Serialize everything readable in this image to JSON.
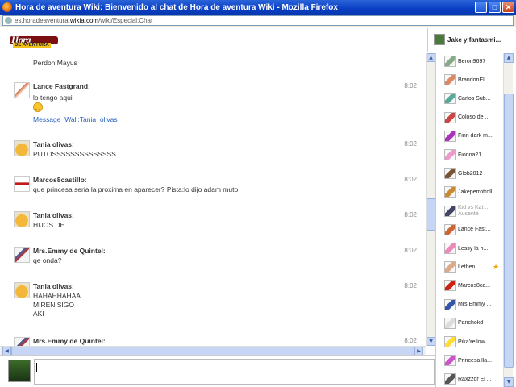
{
  "window": {
    "title": "Hora de aventura Wiki: Bienvenido al chat de Hora de aventura Wiki - Mozilla Firefox",
    "minimize": "_",
    "maximize": "□",
    "close": "✕"
  },
  "address": {
    "prefix": "es.horadeaventura.",
    "domain": "wikia.com",
    "path": "/wiki/Especial:Chat"
  },
  "header": {
    "logo_text": "Hora",
    "logo_sub": "DE AVENTURA",
    "current_user": "Jake y fantasmi..."
  },
  "messages": [
    {
      "author": "",
      "time": "",
      "lines": [
        "Perdon Mayus"
      ],
      "avatar": "none"
    },
    {
      "author": "Lance Fastgrand:",
      "time": "8:02",
      "lines": [
        "lo tengo aqui"
      ],
      "emoticon": "smiley",
      "link": "Message_Wall:Tania_olivas",
      "avatar": "lance"
    },
    {
      "author": "Tania olivas:",
      "time": "8:02",
      "lines": [
        "PUTOSSSSSSSSSSSSSS"
      ],
      "avatar": "jake"
    },
    {
      "author": "Marcos8castillo:",
      "time": "8:02",
      "lines": [
        "que princesa seria la proxima en aparecer? Pista:lo dijo adam muto"
      ],
      "avatar": "marcos"
    },
    {
      "author": "Tania olivas:",
      "time": "8:02",
      "lines": [
        "HIJOS DE"
      ],
      "avatar": "jake"
    },
    {
      "author": "Mrs.Emmy de Quintel:",
      "time": "8:02",
      "lines": [
        "qe onda?"
      ],
      "avatar": "emmy"
    },
    {
      "author": "Tania olivas:",
      "time": "8:02",
      "lines": [
        "HAHAHHAHAA",
        "MIREN SIGO",
        "AKI"
      ],
      "avatar": "jake"
    },
    {
      "author": "Mrs.Emmy de Quintel:",
      "time": "8:02",
      "lines": [],
      "avatar": "emmy"
    }
  ],
  "users": [
    {
      "name": "Beron9697",
      "color": "#8a8"
    },
    {
      "name": "BrandonEl...",
      "color": "#d86"
    },
    {
      "name": "Carlos Sub...",
      "color": "#5a9"
    },
    {
      "name": "Coloso de ...",
      "color": "#c44"
    },
    {
      "name": "Finn dark m...",
      "color": "#a3b"
    },
    {
      "name": "Fionna21",
      "color": "#e9c"
    },
    {
      "name": "Glob2012",
      "color": "#753"
    },
    {
      "name": "Jakeperrotroll",
      "color": "#c83"
    },
    {
      "name": "Kid vs Kat ...",
      "status": "Ausente",
      "away": true,
      "color": "#446"
    },
    {
      "name": "Lance Fast...",
      "color": "#c63"
    },
    {
      "name": "Lessy la h...",
      "color": "#e8b"
    },
    {
      "name": "Lethen",
      "star": true,
      "color": "#da8"
    },
    {
      "name": "Marcos8ca...",
      "color": "#c21"
    },
    {
      "name": "Mrs.Emmy ...",
      "color": "#35a"
    },
    {
      "name": "Panchokd",
      "color": "#ddd"
    },
    {
      "name": "PikaYellow",
      "color": "#fd3"
    },
    {
      "name": "Princesa lla...",
      "color": "#c5c"
    },
    {
      "name": "Raxzzor El ...",
      "color": "#555"
    }
  ],
  "scroll": {
    "up": "▲",
    "down": "▼",
    "left": "◀",
    "right": "▶"
  }
}
